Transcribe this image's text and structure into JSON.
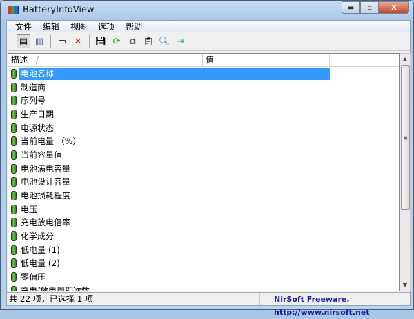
{
  "window": {
    "title": "BatteryInfoView",
    "min": "▬",
    "max": "▫",
    "close": "X"
  },
  "menu": [
    "文件",
    "编辑",
    "视图",
    "选项",
    "帮助"
  ],
  "toolbar": [
    {
      "icon": "html-report-icon"
    },
    {
      "icon": "properties-icon"
    },
    {
      "icon": "window-icon"
    },
    {
      "icon": "delete-icon"
    },
    {
      "icon": "save-icon"
    },
    {
      "icon": "refresh-icon"
    },
    {
      "icon": "copy-icon"
    },
    {
      "icon": "clipboard-icon"
    },
    {
      "icon": "find-icon"
    },
    {
      "icon": "exit-icon"
    }
  ],
  "columns": [
    "描述",
    "值"
  ],
  "sort_indicator": "/",
  "rows": [
    "电池名称",
    "制造商",
    "序列号",
    "生产日期",
    "电源状态",
    "当前电量 （%）",
    "当前容量值",
    "电池满电容量",
    "电池设计容量",
    "电池损耗程度",
    "电压",
    "充电放电倍率",
    "化学成分",
    "低电量 (1)",
    "低电量 (2)",
    "零偏压",
    "充电/放电周期次数"
  ],
  "selected_index": 0,
  "status": {
    "count": "共 22 项，已选择 1 项",
    "credit": "NirSoft Freeware.  http://www.nirsoft.net"
  },
  "colors": {
    "selection": "#3399ff",
    "credit": "#1a1aa6"
  }
}
